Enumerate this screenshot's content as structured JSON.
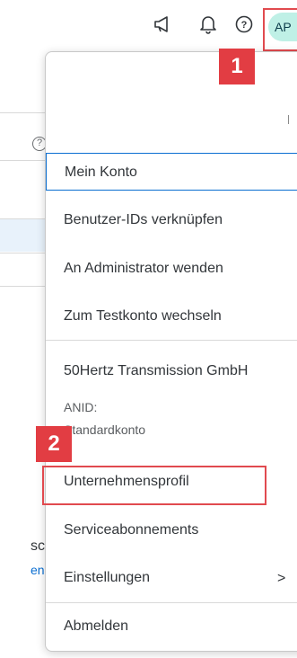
{
  "header": {
    "icons": [
      "megaphone-icon",
      "bell-icon",
      "help-icon"
    ],
    "avatar_initials": "AP"
  },
  "annotations": {
    "badge1": "1",
    "badge2": "2"
  },
  "background": {
    "text_fragment": "sc",
    "link_fragment": "en",
    "help_glyph": "?"
  },
  "menu": {
    "items": [
      {
        "label": "Mein Konto",
        "selected": true
      },
      {
        "label": "Benutzer-IDs verknüpfen"
      },
      {
        "label": "An Administrator wenden"
      },
      {
        "label": "Zum Testkonto wechseln"
      }
    ],
    "company": {
      "name": "50Hertz Transmission GmbH",
      "anid_label": "ANID:",
      "account_type": "Standardkonto"
    },
    "items2": [
      {
        "label": "Unternehmensprofil"
      },
      {
        "label": "Serviceabonnements"
      },
      {
        "label": "Einstellungen",
        "chevron": ">"
      }
    ],
    "logout": "Abmelden"
  },
  "colors": {
    "accent": "#0a6ed1",
    "annotation_red": "#e23d43",
    "avatar_bg": "#bff0e6"
  }
}
